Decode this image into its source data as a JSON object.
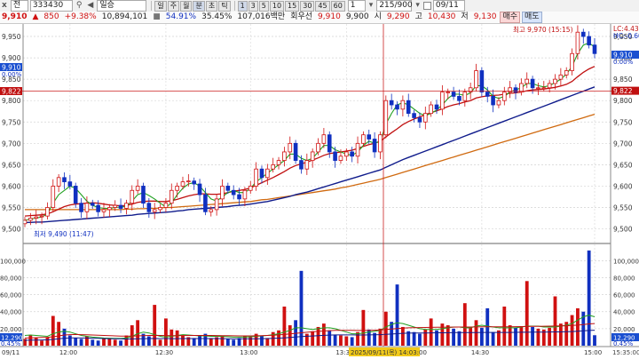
{
  "toolbar1": {
    "close_label": "x",
    "market_select": "전",
    "code_input": "333430",
    "stock_name": "일승",
    "period_buttons": [
      "일",
      "주",
      "월",
      "분",
      "초",
      "틱"
    ],
    "period_active": "분",
    "minute_buttons": [
      "1",
      "3",
      "5",
      "10",
      "15",
      "30",
      "45",
      "60"
    ],
    "count_value": "1",
    "range_value": "215/900",
    "date_value": "09/11"
  },
  "toolbar2": {
    "price": "9,910",
    "change": "850",
    "change_rate": "+9.38%",
    "volume": "10,894,101",
    "ratio1": "54.91%",
    "ratio2": "35.45%",
    "amount": "107,016백만",
    "trade_label": "회우선",
    "ask": "9,910",
    "bid": "9,900",
    "open_label": "시",
    "open": "9,290",
    "high_label": "고",
    "high": "10,430",
    "low_label": "저",
    "low": "9,130",
    "buy_button": "매수",
    "sell_button": "매도"
  },
  "chart_data": {
    "type": "candlestick",
    "legend": [
      "LC:4.43",
      "HC:-0.60"
    ],
    "price_axis": [
      "9,950",
      "9,900",
      "9,850",
      "9,800",
      "9,750",
      "9,700",
      "9,650",
      "9,600",
      "9,550",
      "9,500"
    ],
    "price_ylim": [
      9470,
      9975
    ],
    "current_price_tag": "9,910",
    "current_change_tag": "0.00%",
    "crosshair_price_tag": "9,822",
    "high_annotation": "최고 9,970 (15:15)",
    "low_annotation": "최저 9,490 (11:47)",
    "volume_axis": [
      "100,000",
      "80,000",
      "60,000",
      "40,000",
      "20,000"
    ],
    "volume_ylim": [
      0,
      115000
    ],
    "current_volume_tag": "12,290",
    "current_volume_pct": "0.45%",
    "volume_axis_bottom_pct": "0.45%",
    "time_labels": [
      "09/11",
      "12:00",
      "12:30",
      "13:00",
      "13:30",
      "14:30",
      "15:00"
    ],
    "crosshair_time_label": "2025/09/11(목) 14:03:00",
    "bottom_right_time": "15:35:00",
    "close": [
      9520,
      9525,
      9528,
      9530,
      9550,
      9600,
      9620,
      9610,
      9600,
      9560,
      9540,
      9560,
      9555,
      9540,
      9545,
      9550,
      9555,
      9548,
      9560,
      9590,
      9600,
      9560,
      9540,
      9545,
      9550,
      9560,
      9590,
      9600,
      9610,
      9612,
      9605,
      9580,
      9540,
      9545,
      9570,
      9600,
      9590,
      9580,
      9570,
      9590,
      9600,
      9640,
      9620,
      9640,
      9650,
      9660,
      9680,
      9700,
      9660,
      9640,
      9660,
      9680,
      9700,
      9720,
      9680,
      9660,
      9670,
      9680,
      9670,
      9700,
      9720,
      9710,
      9680,
      9720,
      9800,
      9790,
      9780,
      9800,
      9770,
      9760,
      9750,
      9770,
      9790,
      9780,
      9820,
      9820,
      9810,
      9800,
      9820,
      9830,
      9870,
      9820,
      9810,
      9790,
      9800,
      9820,
      9830,
      9820,
      9840,
      9850,
      9830,
      9830,
      9830,
      9840,
      9850,
      9860,
      9870,
      9910,
      9960,
      9950,
      9930,
      9910
    ],
    "ma5": [
      9520,
      9523,
      9525,
      9528,
      9535,
      9560,
      9580,
      9590,
      9600,
      9595,
      9580,
      9565,
      9555,
      9550,
      9548,
      9548,
      9550,
      9551,
      9553,
      9565,
      9580,
      9585,
      9578,
      9570,
      9560,
      9551,
      9560,
      9580,
      9595,
      9605,
      9608,
      9600,
      9585,
      9570,
      9565,
      9575,
      9585,
      9590,
      9585,
      9585,
      9595,
      9610,
      9620,
      9630,
      9640,
      9650,
      9660,
      9675,
      9675,
      9665,
      9660,
      9665,
      9680,
      9695,
      9695,
      9685,
      9680,
      9675,
      9672,
      9680,
      9695,
      9705,
      9700,
      9705,
      9745,
      9770,
      9790,
      9795,
      9790,
      9780,
      9770,
      9765,
      9770,
      9778,
      9790,
      9805,
      9815,
      9815,
      9812,
      9818,
      9835,
      9835,
      9825,
      9810,
      9805,
      9810,
      9820,
      9825,
      9830,
      9840,
      9840,
      9835,
      9832,
      9835,
      9842,
      9850,
      9862,
      9880,
      9910,
      9930,
      9935,
      9925
    ],
    "ma20": [
      9530,
      9531,
      9532,
      9533,
      9535,
      9540,
      9546,
      9552,
      9556,
      9558,
      9559,
      9560,
      9561,
      9560,
      9558,
      9556,
      9555,
      9554,
      9555,
      9558,
      9562,
      9564,
      9565,
      9565,
      9564,
      9564,
      9566,
      9569,
      9573,
      9577,
      9580,
      9582,
      9582,
      9581,
      9581,
      9582,
      9585,
      9588,
      9590,
      9592,
      9596,
      9602,
      9608,
      9614,
      9620,
      9627,
      9634,
      9642,
      9648,
      9652,
      9656,
      9661,
      9666,
      9672,
      9676,
      9678,
      9680,
      9682,
      9684,
      9688,
      9693,
      9697,
      9700,
      9705,
      9715,
      9725,
      9734,
      9744,
      9751,
      9757,
      9762,
      9767,
      9772,
      9776,
      9781,
      9786,
      9790,
      9793,
      9797,
      9800,
      9806,
      9809,
      9811,
      9812,
      9813,
      9815,
      9817,
      9818,
      9820,
      9823,
      9825,
      9826,
      9827,
      9829,
      9831,
      9834,
      9838,
      9845,
      9856,
      9866,
      9874,
      9880
    ],
    "ma60": [
      9515,
      9515,
      9516,
      9516,
      9517,
      9518,
      9519,
      9520,
      9521,
      9522,
      9523,
      9524,
      9525,
      9526,
      9527,
      9528,
      9529,
      9530,
      9531,
      9532,
      9534,
      9535,
      9536,
      9537,
      9538,
      9539,
      9540,
      9542,
      9543,
      9545,
      9546,
      9547,
      9548,
      9549,
      9550,
      9551,
      9552,
      9554,
      9555,
      9556,
      9558,
      9560,
      9562,
      9564,
      9567,
      9570,
      9573,
      9576,
      9580,
      9583,
      9586,
      9590,
      9594,
      9598,
      9602,
      9606,
      9610,
      9614,
      9618,
      9622,
      9626,
      9630,
      9634,
      9638,
      9644,
      9650,
      9656,
      9662,
      9667,
      9672,
      9677,
      9682,
      9687,
      9692,
      9697,
      9702,
      9707,
      9712,
      9717,
      9722,
      9727,
      9732,
      9737,
      9742,
      9747,
      9752,
      9757,
      9762,
      9767,
      9772,
      9777,
      9782,
      9787,
      9792,
      9797,
      9802,
      9807,
      9812,
      9817,
      9822,
      9827,
      9832
    ],
    "ma120": [
      9545,
      9545,
      9545,
      9545,
      9545,
      9545,
      9545,
      9545,
      9545,
      9545,
      9545,
      9545,
      9545,
      9545,
      9545,
      9545,
      9545,
      9545,
      9546,
      9546,
      9547,
      9547,
      9548,
      9548,
      9549,
      9550,
      9550,
      9551,
      9552,
      9553,
      9554,
      9555,
      9556,
      9557,
      9558,
      9559,
      9560,
      9561,
      9562,
      9563,
      9564,
      9566,
      9568,
      9569,
      9571,
      9573,
      9575,
      9577,
      9579,
      9581,
      9583,
      9585,
      9587,
      9589,
      9591,
      9593,
      9596,
      9598,
      9601,
      9604,
      9607,
      9610,
      9613,
      9616,
      9620,
      9624,
      9628,
      9632,
      9636,
      9640,
      9644,
      9648,
      9652,
      9656,
      9660,
      9664,
      9668,
      9672,
      9676,
      9680,
      9684,
      9688,
      9692,
      9696,
      9700,
      9704,
      9708,
      9712,
      9716,
      9720,
      9724,
      9728,
      9732,
      9736,
      9740,
      9744,
      9748,
      9752,
      9756,
      9760,
      9764,
      9768
    ],
    "volume": [
      8000,
      12000,
      9000,
      6000,
      10000,
      35000,
      28000,
      20000,
      12000,
      9000,
      8000,
      11000,
      7000,
      6000,
      9000,
      8000,
      7000,
      6000,
      12000,
      24000,
      30000,
      14000,
      11000,
      9000,
      7000,
      8000,
      19000,
      18000,
      12000,
      10000,
      9000,
      12000,
      14000,
      9000,
      10000,
      12000,
      8000,
      7000,
      9000,
      11000,
      10000,
      14000,
      12000,
      9000,
      16000,
      18000,
      21000,
      24000,
      30000,
      20000,
      14000,
      17000,
      22000,
      26000,
      18000,
      13000,
      12000,
      11000,
      10000,
      16000,
      22000,
      19000,
      15000,
      20000,
      40000,
      28000,
      26000,
      22000,
      17000,
      16000,
      14000,
      19000,
      21000,
      18000,
      26000,
      24000,
      20000,
      17000,
      21000,
      22000,
      30000,
      21000,
      19000,
      16000,
      18000,
      21000,
      24000,
      21000,
      23000,
      28000,
      22000,
      20000,
      19000,
      21000,
      24000,
      26000,
      28000,
      36000,
      52000,
      40000,
      30000,
      12290
    ],
    "volume_spikes": [
      [
        23,
        48000
      ],
      [
        25,
        32000
      ],
      [
        46,
        46000
      ],
      [
        49,
        88000
      ],
      [
        60,
        42000
      ],
      [
        66,
        72000
      ],
      [
        72,
        32000
      ],
      [
        78,
        50000
      ],
      [
        82,
        44000
      ],
      [
        85,
        46000
      ],
      [
        89,
        76000
      ],
      [
        94,
        58000
      ],
      [
        98,
        44000
      ],
      [
        100,
        112000
      ]
    ],
    "vol_ma": [
      12000,
      12500,
      12000,
      11500,
      11000,
      14000,
      16000,
      17000,
      16000,
      14000,
      12000,
      11000,
      10000,
      9500,
      9000,
      8800,
      8600,
      8500,
      9000,
      11000,
      14000,
      16000,
      15000,
      13000,
      11000,
      10000,
      11000,
      12000,
      13000,
      12500,
      12000,
      11500,
      11500,
      11000,
      11000,
      11000,
      10500,
      10000,
      10000,
      10000,
      10500,
      11000,
      11500,
      12000,
      13000,
      14000,
      16000,
      18000,
      21000,
      21000,
      20000,
      19000,
      20000,
      21000,
      21000,
      20000,
      18000,
      16000,
      14000,
      14000,
      15000,
      16000,
      17000,
      18000,
      22000,
      25000,
      27000,
      26000,
      24000,
      22000,
      20000,
      19000,
      19000,
      19000,
      20000,
      21000,
      22000,
      22000,
      21000,
      21000,
      23000,
      24000,
      23000,
      22000,
      21000,
      21000,
      21000,
      21000,
      22000,
      23000,
      23000,
      23000,
      22000,
      22000,
      22000,
      23000,
      24000,
      26000,
      30000,
      34000,
      36000,
      34000
    ],
    "vol_ma2": [
      9000,
      9200,
      9400,
      9600,
      9800,
      10500,
      11500,
      12500,
      13000,
      13200,
      13000,
      12800,
      12500,
      12200,
      12000,
      11800,
      11500,
      11300,
      11200,
      11300,
      11500,
      11800,
      12000,
      12100,
      12000,
      11900,
      11800,
      11800,
      11900,
      12000,
      12000,
      12000,
      12000,
      12000,
      11900,
      11800,
      11700,
      11600,
      11500,
      11500,
      11500,
      11600,
      11800,
      12000,
      12300,
      12700,
      13200,
      13800,
      14500,
      15200,
      15800,
      16300,
      16800,
      17300,
      17700,
      18000,
      18100,
      18100,
      18000,
      17900,
      17900,
      18000,
      18200,
      18500,
      19000,
      19600,
      20200,
      20700,
      21000,
      21200,
      21300,
      21400,
      21500,
      21600,
      21700,
      21800,
      21900,
      22000,
      22000,
      22000,
      22100,
      22200,
      22300,
      22300,
      22300,
      22300,
      22300,
      22400,
      22500,
      22600,
      22700,
      22800,
      22900,
      23000,
      23100,
      23200,
      23400,
      23700,
      24200,
      24900,
      25600,
      26000
    ]
  }
}
